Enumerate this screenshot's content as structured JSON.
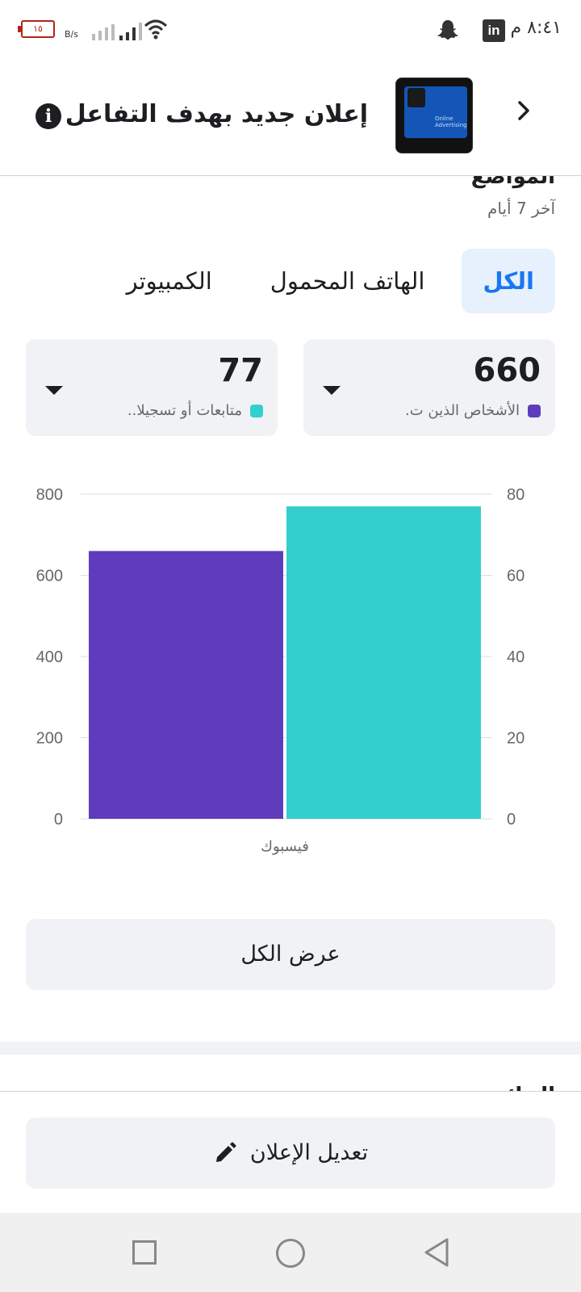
{
  "status_bar": {
    "time": "٨:٤١ م",
    "battery": "١٥",
    "net_speed": "B/s",
    "apps": [
      "snapchat-icon",
      "linkedin-icon"
    ],
    "linkedin_label": "in"
  },
  "header": {
    "title": "إعلان جديد بهدف التفاعل",
    "thumbnail_text": "Online Advertising"
  },
  "section": {
    "title": "المواضع",
    "subtitle": "آخر 7 أيام"
  },
  "tabs": [
    {
      "label": "الكل",
      "active": true
    },
    {
      "label": "الهاتف المحمول",
      "active": false
    },
    {
      "label": "الكمبيوتر",
      "active": false
    }
  ],
  "metrics": [
    {
      "value": "660",
      "label": "الأشخاص الذين ت.",
      "color": "#5e3cbc"
    },
    {
      "value": "77",
      "label": "متابعات أو تسجيلا..",
      "color": "#33cfce"
    }
  ],
  "chart_data": {
    "type": "bar",
    "categories": [
      "فيسبوك"
    ],
    "series": [
      {
        "name": "الأشخاص الذين ت.",
        "values": [
          660
        ],
        "axis": "left",
        "color": "#5e3cbc"
      },
      {
        "name": "متابعات أو تسجيلا..",
        "values": [
          77
        ],
        "axis": "right",
        "color": "#33cfce"
      }
    ],
    "y_left_ticks": [
      0,
      200,
      400,
      600,
      800
    ],
    "y_right_ticks": [
      0,
      20,
      40,
      60,
      80
    ],
    "ylim_left": [
      0,
      800
    ],
    "ylim_right": [
      0,
      80
    ],
    "grid": true
  },
  "buttons": {
    "view_all": "عرض الكل",
    "edit_ad": "تعديل الإعلان"
  },
  "next_section": {
    "title": "النتائج"
  }
}
